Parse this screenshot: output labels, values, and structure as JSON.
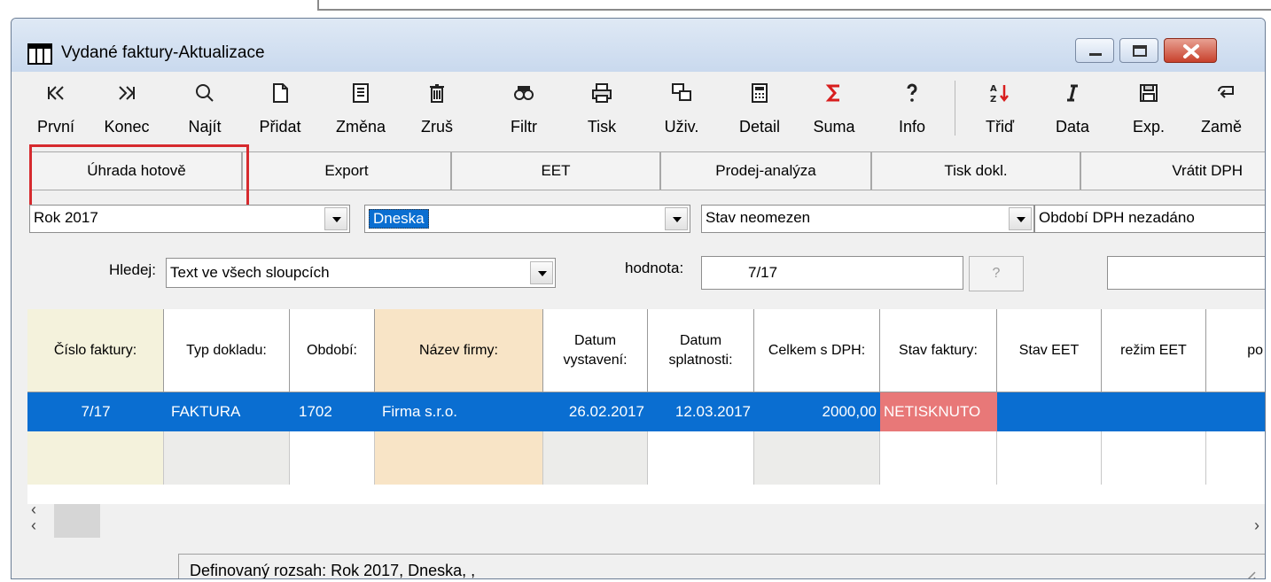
{
  "window": {
    "title": "Vydané faktury-Aktualizace"
  },
  "toolbar": {
    "items": [
      {
        "label": "První",
        "icon": "first-record-icon"
      },
      {
        "label": "Konec",
        "icon": "last-record-icon"
      },
      {
        "label": "Najít",
        "icon": "search-icon"
      },
      {
        "label": "Přidat",
        "icon": "new-document-icon"
      },
      {
        "label": "Změna",
        "icon": "edit-document-icon"
      },
      {
        "label": "Zruš",
        "icon": "trash-icon"
      },
      {
        "label": "Filtr",
        "icon": "binoculars-icon"
      },
      {
        "label": "Tisk",
        "icon": "printer-icon"
      },
      {
        "label": "Uživ.",
        "icon": "user-windows-icon"
      },
      {
        "label": "Detail",
        "icon": "calculator-detail-icon"
      },
      {
        "label": "Suma",
        "icon": "sigma-icon"
      },
      {
        "label": "Info",
        "icon": "question-icon"
      },
      {
        "label": "Třiď",
        "icon": "sort-az-icon"
      },
      {
        "label": "Data",
        "icon": "italic-data-icon"
      },
      {
        "label": "Exp.",
        "icon": "save-icon"
      },
      {
        "label": "Zamě",
        "icon": "swap-icon"
      }
    ]
  },
  "tabs": [
    "Úhrada hotově",
    "Export",
    "EET",
    "Prodej-analýza",
    "Tisk dokl.",
    "Vrátit DPH"
  ],
  "filters": {
    "year": "Rok 2017",
    "period": "Dneska",
    "state": "Stav neomezen",
    "vat_period": "Období DPH nezadáno"
  },
  "search": {
    "label": "Hledej:",
    "mode": "Text ve všech sloupcích",
    "value_label": "hodnota:",
    "value": "7/17",
    "help_button": "?"
  },
  "table": {
    "headers": [
      "Číslo faktury:",
      "Typ dokladu:",
      "Období:",
      "Název firmy:",
      "Datum vystavení:",
      "Datum splatnosti:",
      "Celkem s DPH:",
      "Stav faktury:",
      "Stav EET",
      "režim EET",
      "po"
    ],
    "rows": [
      [
        "7/17",
        "FAKTURA",
        "1702",
        "Firma s.r.o.",
        "26.02.2017",
        "12.03.2017",
        "2000,00",
        "NETISKNUTO",
        "",
        "",
        ""
      ]
    ]
  },
  "status": {
    "text": "Definovaný rozsah: Rok 2017, Dneska, ,"
  },
  "colors": {
    "selection": "#0a6ed1",
    "highlight_border": "#d62a2e",
    "netisknuto_bg": "#e87878",
    "col_number_bg": "#f4f2dc",
    "col_firm_bg": "#f8e4c6",
    "col_gray_bg": "#ececea"
  }
}
